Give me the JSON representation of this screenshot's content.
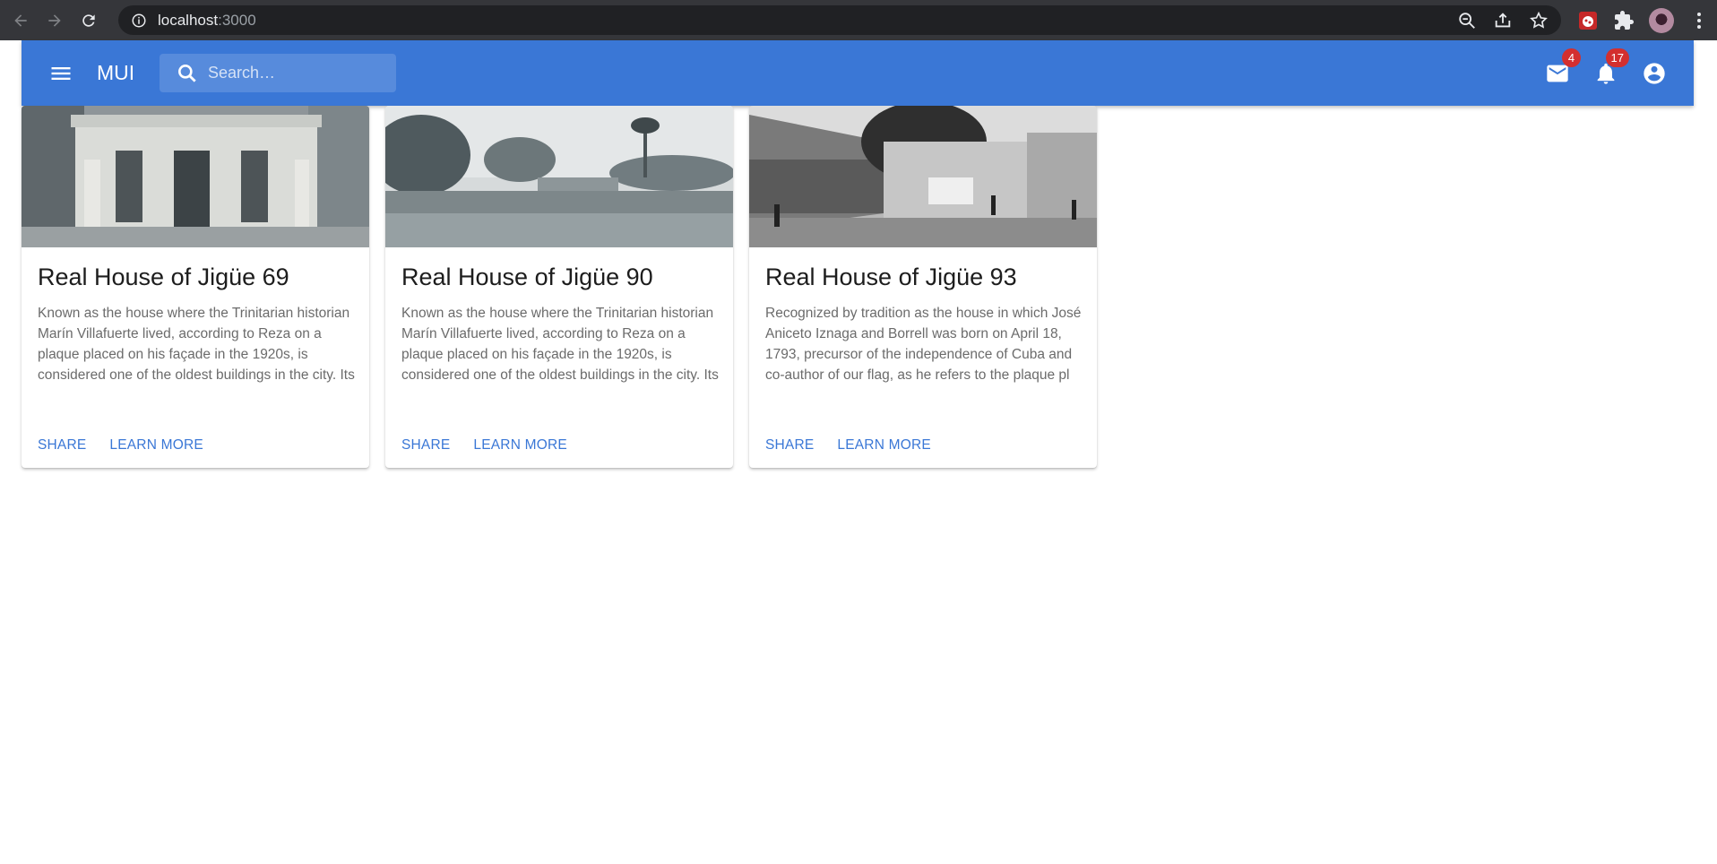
{
  "browser": {
    "url_host": "localhost",
    "url_port": ":3000"
  },
  "appbar": {
    "brand": "MUI",
    "search_placeholder": "Search…",
    "mail_badge": "4",
    "notifications_badge": "17",
    "color": "#3a77d6"
  },
  "cards": [
    {
      "title": "Real House of Jigüe 69",
      "text": "Known as the house where the Trinitarian historian Marín Villafuerte lived, according to Reza on a plaque placed on his façade in the 1920s, is considered one of the oldest buildings in the city. Its",
      "share_label": "Share",
      "learn_more_label": "Learn More"
    },
    {
      "title": "Real House of Jigüe 90",
      "text": "Known as the house where the Trinitarian historian Marín Villafuerte lived, according to Reza on a plaque placed on his façade in the 1920s, is considered one of the oldest buildings in the city. Its",
      "share_label": "Share",
      "learn_more_label": "Learn More"
    },
    {
      "title": "Real House of Jigüe 93",
      "text": "Recognized by tradition as the house in which José Aniceto Iznaga and Borrell was born on April 18, 1793, precursor of the independence of Cuba and co-author of our flag, as he refers to the plaque pl",
      "share_label": "Share",
      "learn_more_label": "Learn More"
    }
  ]
}
